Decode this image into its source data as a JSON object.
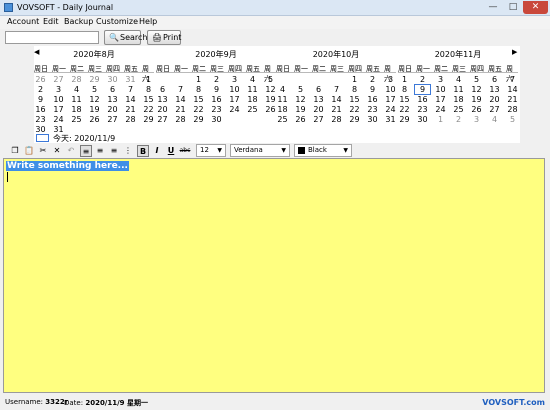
{
  "window": {
    "title": "VOVSOFT - Daily Journal",
    "min_glyph": "—",
    "max_glyph": "□",
    "close_glyph": "✕"
  },
  "menu": [
    "Account",
    "Edit",
    "Backup",
    "Customize",
    "Help"
  ],
  "toolbar": {
    "search_label": "Search",
    "print_label": "Print",
    "search_value": ""
  },
  "calendar": {
    "prev": "◀",
    "next": "▶",
    "weekdays": [
      "周日",
      "周一",
      "周二",
      "周三",
      "周四",
      "周五",
      "周六"
    ],
    "months": [
      {
        "title": "2020年8月",
        "weeks": [
          [
            "26",
            "27",
            "28",
            "29",
            "30",
            "31",
            "1"
          ],
          [
            "2",
            "3",
            "4",
            "5",
            "6",
            "7",
            "8"
          ],
          [
            "9",
            "10",
            "11",
            "12",
            "13",
            "14",
            "15"
          ],
          [
            "16",
            "17",
            "18",
            "19",
            "20",
            "21",
            "22"
          ],
          [
            "23",
            "24",
            "25",
            "26",
            "27",
            "28",
            "29"
          ],
          [
            "30",
            "31",
            "",
            "",
            "",
            "",
            ""
          ]
        ]
      },
      {
        "title": "2020年9月",
        "weeks": [
          [
            "",
            "",
            "1",
            "2",
            "3",
            "4",
            "5"
          ],
          [
            "6",
            "7",
            "8",
            "9",
            "10",
            "11",
            "12"
          ],
          [
            "13",
            "14",
            "15",
            "16",
            "17",
            "18",
            "19"
          ],
          [
            "20",
            "21",
            "22",
            "23",
            "24",
            "25",
            "26"
          ],
          [
            "27",
            "28",
            "29",
            "30",
            "",
            "",
            ""
          ]
        ]
      },
      {
        "title": "2020年10月",
        "weeks": [
          [
            "",
            "",
            "",
            "",
            "1",
            "2",
            "3"
          ],
          [
            "4",
            "5",
            "6",
            "7",
            "8",
            "9",
            "10"
          ],
          [
            "11",
            "12",
            "13",
            "14",
            "15",
            "16",
            "17"
          ],
          [
            "18",
            "19",
            "20",
            "21",
            "22",
            "23",
            "24"
          ],
          [
            "25",
            "26",
            "27",
            "28",
            "29",
            "30",
            "31"
          ]
        ]
      },
      {
        "title": "2020年11月",
        "weeks": [
          [
            "1",
            "2",
            "3",
            "4",
            "5",
            "6",
            "7"
          ],
          [
            "8",
            "9",
            "10",
            "11",
            "12",
            "13",
            "14"
          ],
          [
            "15",
            "16",
            "17",
            "18",
            "19",
            "20",
            "21"
          ],
          [
            "22",
            "23",
            "24",
            "25",
            "26",
            "27",
            "28"
          ],
          [
            "29",
            "30",
            "1",
            "2",
            "3",
            "4",
            "5"
          ]
        ]
      }
    ],
    "today_label": "今天: 2020/11/9"
  },
  "format": {
    "font_size": "12",
    "font_name": "Verdana",
    "font_color": "Black"
  },
  "editor": {
    "text": "Write something here...",
    "background": "#ffff80",
    "selection": "#3f8fe6"
  },
  "status": {
    "username_label": "Username:",
    "username": "3322r",
    "date_label": "Date:",
    "date": "2020/11/9 星期一",
    "brand": "VOVSOFT.com"
  }
}
